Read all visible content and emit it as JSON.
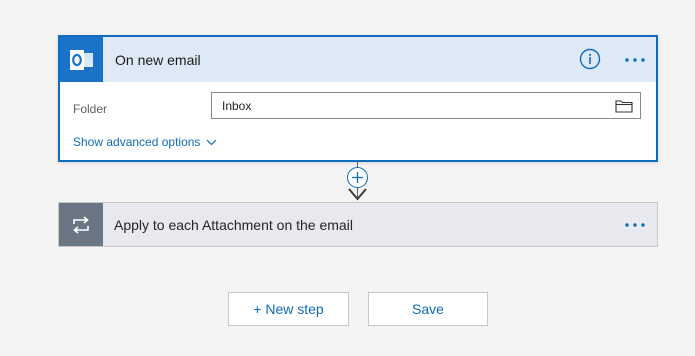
{
  "trigger": {
    "icon": "outlook-icon",
    "title": "On new email",
    "info_icon": "info-icon",
    "more_icon": "more-dots-icon",
    "folder_label": "Folder",
    "folder_value": "Inbox",
    "folder_icon": "folder-icon",
    "advanced_label": "Show advanced options",
    "advanced_icon": "chevron-down-icon"
  },
  "connector": {
    "add_icon": "plus-icon",
    "arrow_icon": "arrow-down-icon"
  },
  "loop": {
    "icon": "loop-icon",
    "title": "Apply to each Attachment on the email",
    "more_icon": "more-dots-icon"
  },
  "buttons": {
    "new_step": "+ New step",
    "save": "Save"
  },
  "colors": {
    "accent": "#0f6cbd",
    "trigger_header_bg": "#dde9f6",
    "outlook_blue": "#1a73c9",
    "loop_icon_bg": "#6b7684",
    "loop_card_bg": "#e8e9ee",
    "page_bg": "#f4f4f4"
  }
}
